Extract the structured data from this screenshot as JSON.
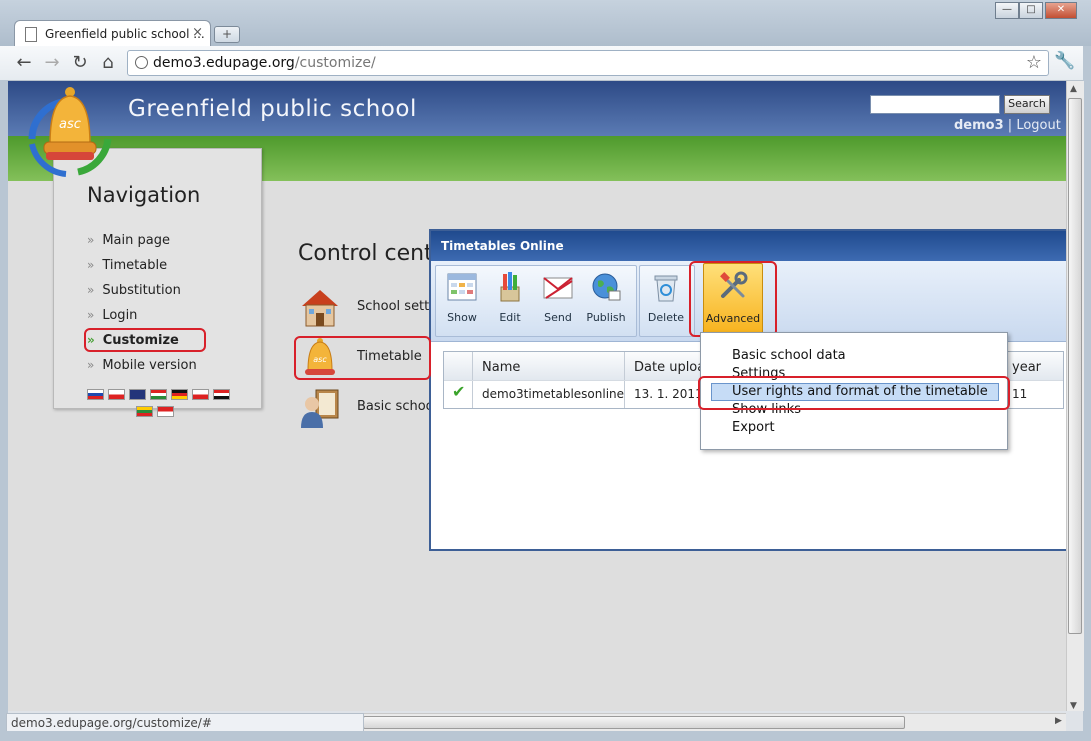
{
  "browser": {
    "tab_title": "Greenfield public school ...",
    "tab_close": "×",
    "new_tab": "+",
    "url_host": "demo3.edupage.org",
    "url_path": "/customize/",
    "window_buttons": [
      "—",
      "□",
      "✕"
    ],
    "nav_icons": [
      "back-arrow-icon",
      "forward-arrow-icon",
      "reload-icon",
      "home-icon"
    ],
    "status_url": "demo3.edupage.org/customize/#"
  },
  "header": {
    "school_name": "Greenfield public school",
    "search_button": "Search",
    "username": "demo3",
    "separator": "|",
    "logout": "Logout",
    "colors": {
      "blue": "#2d4a86",
      "green": "#5ea83b"
    }
  },
  "navigation": {
    "title": "Navigation",
    "items": [
      {
        "label": "Main page"
      },
      {
        "label": "Timetable"
      },
      {
        "label": "Substitution"
      },
      {
        "label": "Login"
      },
      {
        "label": "Customize",
        "active": true
      },
      {
        "label": "Mobile version"
      }
    ]
  },
  "control_center": {
    "title": "Control cent",
    "items": [
      {
        "label": "School setti",
        "icon": "house-icon"
      },
      {
        "label": "Timetable",
        "icon": "bell-icon"
      },
      {
        "label": "Basic schoo",
        "icon": "teacher-icon"
      }
    ]
  },
  "dialog": {
    "title": "Timetables Online",
    "toolbar": [
      {
        "label": "Show",
        "icon": "grid-icon"
      },
      {
        "label": "Edit",
        "icon": "pencils-icon"
      },
      {
        "label": "Send",
        "icon": "envelope-icon"
      },
      {
        "label": "Publish",
        "icon": "globe-icon"
      },
      {
        "label": "Delete",
        "icon": "recycle-bin-icon"
      },
      {
        "label": "Advanced",
        "icon": "tools-icon"
      }
    ],
    "grid": {
      "headers": [
        "Name",
        "Date uploa",
        "year"
      ],
      "row": {
        "name": "demo3timetablesonline",
        "date": "13. 1. 2011",
        "year": "11"
      }
    }
  },
  "advanced_menu": {
    "items": [
      "Basic school data",
      "Settings",
      "User rights and format of the timetable",
      "Show links",
      "Export"
    ],
    "selected_index": 2
  }
}
